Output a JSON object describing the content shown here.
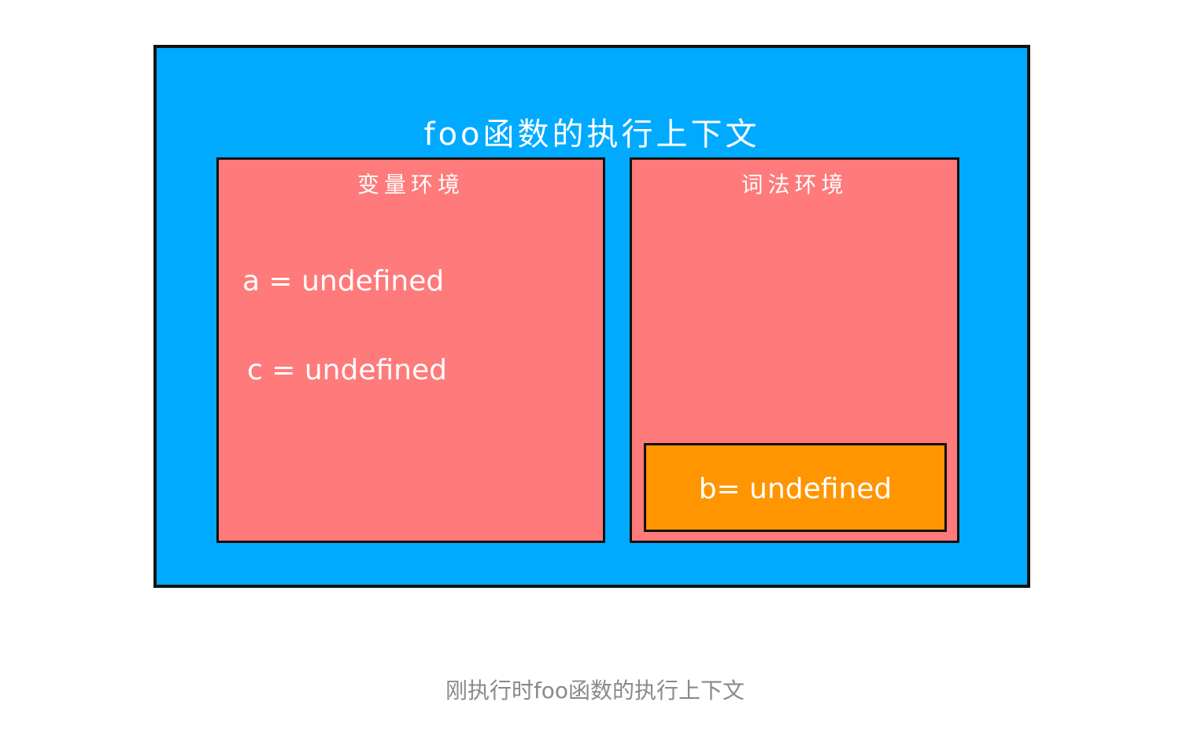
{
  "diagram": {
    "context_title": "foo函数的执行上下文",
    "variable_environment": {
      "title": "变量环境",
      "entries": [
        "a = undefined",
        "c = undefined"
      ]
    },
    "lexical_environment": {
      "title": "词法环境",
      "block_entry": "b= undefined"
    },
    "caption": "刚执行时foo函数的执行上下文"
  },
  "colors": {
    "context_background": "#00aaff",
    "environment_background": "#ff7a7a",
    "block_background": "#ff9500",
    "border": "#111111",
    "caption_text": "#8a8a8a"
  }
}
